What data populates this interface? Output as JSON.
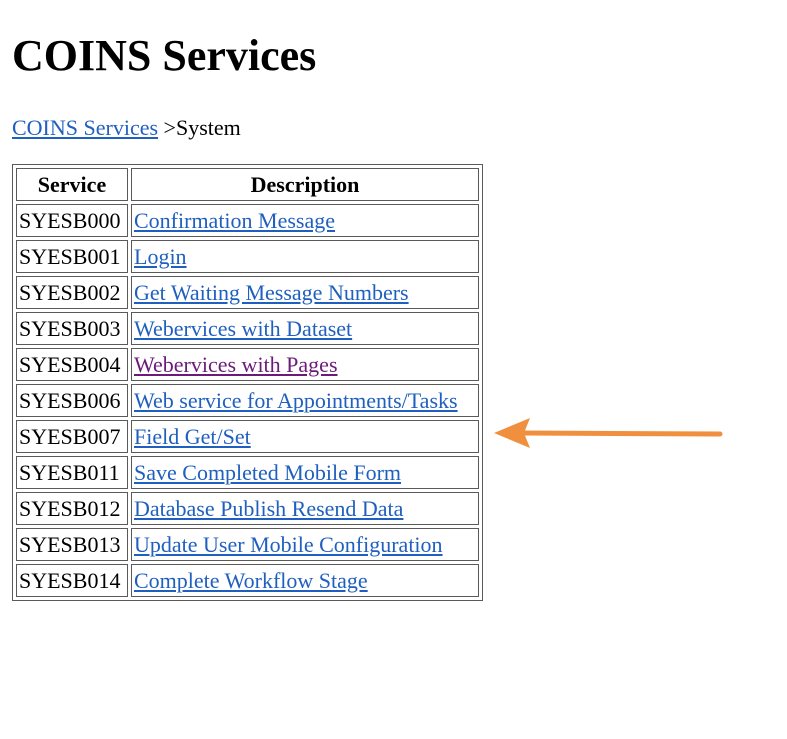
{
  "page": {
    "title": "COINS Services"
  },
  "breadcrumb": {
    "link_label": "COINS Services",
    "separator_and_current": ">System"
  },
  "table": {
    "headers": [
      "Service",
      "Description"
    ],
    "rows": [
      {
        "code": "SYESB000",
        "description": "Confirmation Message",
        "visited": false
      },
      {
        "code": "SYESB001",
        "description": "Login",
        "visited": false
      },
      {
        "code": "SYESB002",
        "description": "Get Waiting Message Numbers",
        "visited": false
      },
      {
        "code": "SYESB003",
        "description": "Webervices with Dataset",
        "visited": false
      },
      {
        "code": "SYESB004",
        "description": "Webervices with Pages",
        "visited": true
      },
      {
        "code": "SYESB006",
        "description": "Web service for Appointments/Tasks",
        "visited": false
      },
      {
        "code": "SYESB007",
        "description": "Field Get/Set",
        "visited": false
      },
      {
        "code": "SYESB011",
        "description": "Save Completed Mobile Form",
        "visited": false
      },
      {
        "code": "SYESB012",
        "description": "Database Publish Resend Data",
        "visited": false
      },
      {
        "code": "SYESB013",
        "description": "Update User Mobile Configuration",
        "visited": false
      },
      {
        "code": "SYESB014",
        "description": "Complete Workflow Stage",
        "visited": false
      }
    ]
  },
  "annotation": {
    "icon": "arrow-left-icon",
    "color": "#f0903f",
    "points_to_row": "SYESB007"
  },
  "colors": {
    "link": "#1f5fbf",
    "visited_link": "#6b1a7a",
    "table_border": "#5a5a5a"
  }
}
